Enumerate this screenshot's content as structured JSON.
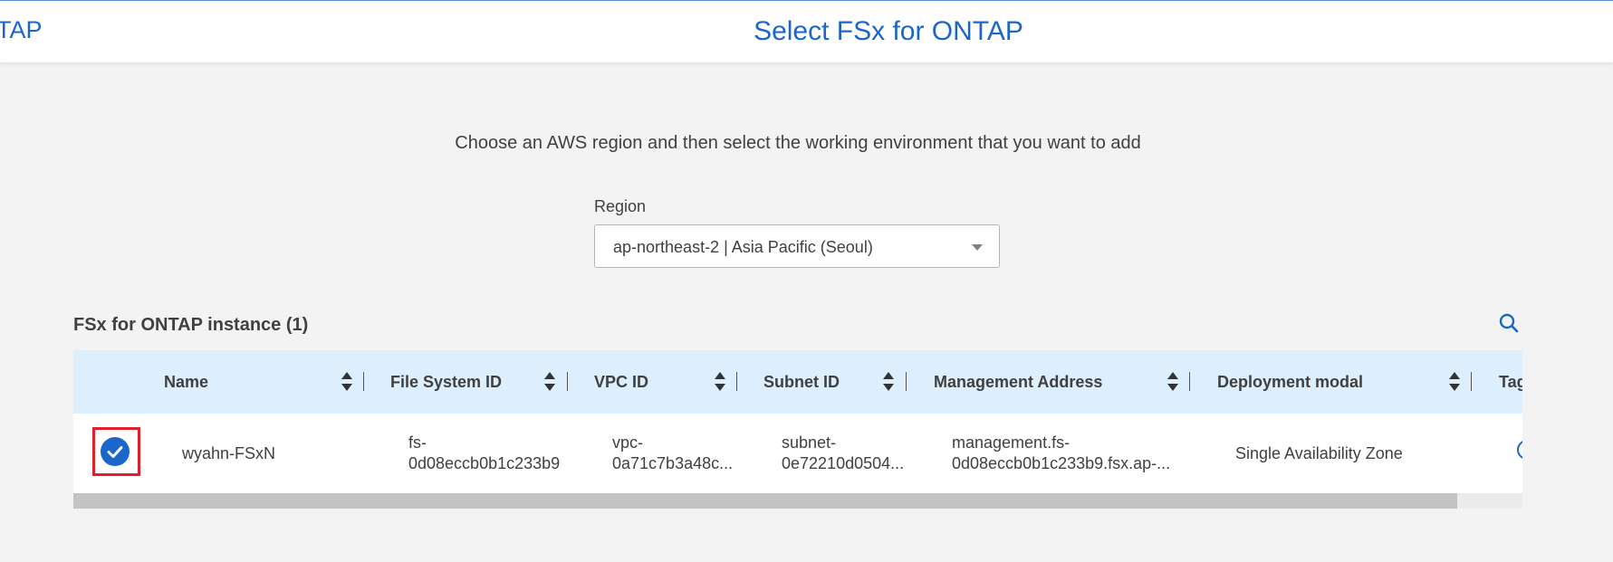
{
  "header": {
    "breadcrumb": "TAP",
    "title": "Select FSx for ONTAP"
  },
  "main": {
    "subtitle": "Choose an AWS region and then select the working environment that you want to add",
    "region": {
      "label": "Region",
      "selected": "ap-northeast-2 | Asia Pacific (Seoul)"
    },
    "table": {
      "title": "FSx for ONTAP instance (1)",
      "columns": [
        "Name",
        "File System ID",
        "VPC ID",
        "Subnet ID",
        "Management Address",
        "Deployment modal",
        "Tags"
      ],
      "rows": [
        {
          "selected": true,
          "name": "wyahn-FSxN",
          "fs_id_line1": "fs-",
          "fs_id_line2": "0d08eccb0b1c233b9",
          "vpc_line1": "vpc-",
          "vpc_line2": "0a71c7b3a48c...",
          "subnet_line1": "subnet-",
          "subnet_line2": "0e72210d0504...",
          "mgmt_line1": "management.fs-",
          "mgmt_line2": "0d08eccb0b1c233b9.fsx.ap-...",
          "deployment": "Single Availability Zone"
        }
      ]
    }
  },
  "icons": {
    "search": "search-icon",
    "check": "check-icon",
    "sort": "sort-icon",
    "dropdown": "chevron-down-icon"
  },
  "colors": {
    "accent": "#1b67c9",
    "header_bg": "#ddeefc",
    "highlight_border": "#e0202a",
    "page_bg": "#f3f3f3"
  }
}
